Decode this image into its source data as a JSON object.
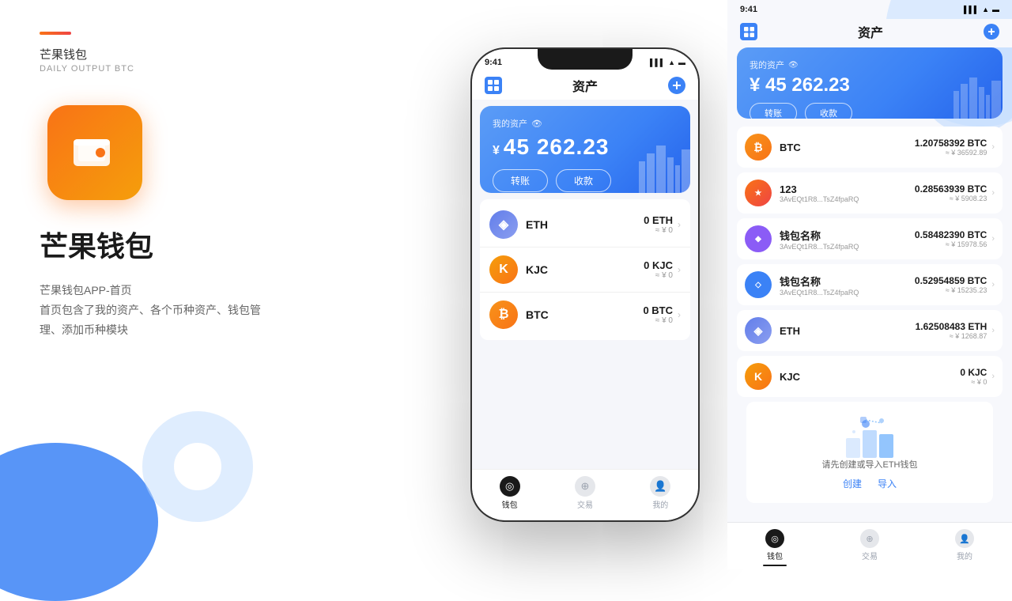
{
  "left": {
    "accent": "#f97316",
    "brand_name": "芒果钱包",
    "brand_subtitle": "DAILY OUTPUT BTC",
    "app_title": "芒果钱包",
    "desc_line1": "芒果钱包APP-首页",
    "desc_line2": "首页包含了我的资产、各个币种资产、钱包管",
    "desc_line3": "理、添加币种模块"
  },
  "phone": {
    "status_time": "9:41",
    "header_title": "资产",
    "asset_label": "我的资产",
    "asset_amount": "45 262.23",
    "asset_symbol": "¥",
    "btn_transfer": "转账",
    "btn_receive": "收款",
    "coins": [
      {
        "id": "eth",
        "name": "ETH",
        "amount": "0 ETH",
        "approx": "≈ ¥ 0"
      },
      {
        "id": "kjc",
        "name": "KJC",
        "amount": "0 KJC",
        "approx": "≈ ¥ 0"
      },
      {
        "id": "btc",
        "name": "BTC",
        "amount": "0 BTC",
        "approx": "≈ ¥ 0"
      }
    ],
    "tabs": [
      {
        "id": "wallet",
        "label": "钱包",
        "active": true
      },
      {
        "id": "trade",
        "label": "交易",
        "active": false
      },
      {
        "id": "mine",
        "label": "我的",
        "active": false
      }
    ]
  },
  "right": {
    "status_time": "9:41",
    "header_title": "资产",
    "asset_label": "我的资产",
    "asset_amount": "45 262.23",
    "asset_symbol": "¥",
    "btn_transfer": "转账",
    "btn_receive": "收款",
    "coins": [
      {
        "id": "btc",
        "name": "BTC",
        "addr": "",
        "amount": "1.20758392 BTC",
        "cny": "≈ ¥ 36592.89",
        "type": "btc"
      },
      {
        "id": "c123",
        "name": "123",
        "addr": "3AvEQt1R8...TsZ4fpaRQ",
        "amount": "0.28563939 BTC",
        "cny": "≈ ¥ 5908.23",
        "type": "c123"
      },
      {
        "id": "pur1",
        "name": "钱包名称",
        "addr": "3AvEQt1R8...TsZ4fpaRQ",
        "amount": "0.58482390 BTC",
        "cny": "≈ ¥ 15978.56",
        "type": "pur"
      },
      {
        "id": "dia1",
        "name": "钱包名称",
        "addr": "3AvEQt1R8...TsZ4fpaRQ",
        "amount": "0.52954859 BTC",
        "cny": "≈ ¥ 15235.23",
        "type": "dia"
      },
      {
        "id": "eth1",
        "name": "ETH",
        "addr": "",
        "amount": "1.62508483 ETH",
        "cny": "≈ ¥ 1268.87",
        "type": "eth"
      },
      {
        "id": "kjc1",
        "name": "KJC",
        "addr": "",
        "amount": "0 KJC",
        "cny": "≈ ¥ 0",
        "type": "kjc"
      }
    ],
    "empty_text": "请先创建或导入ETH钱包",
    "empty_create": "创建",
    "empty_import": "导入",
    "tabs": [
      {
        "id": "wallet",
        "label": "钱包",
        "active": true
      },
      {
        "id": "trade",
        "label": "交易",
        "active": false
      },
      {
        "id": "mine",
        "label": "我的",
        "active": false
      }
    ]
  }
}
